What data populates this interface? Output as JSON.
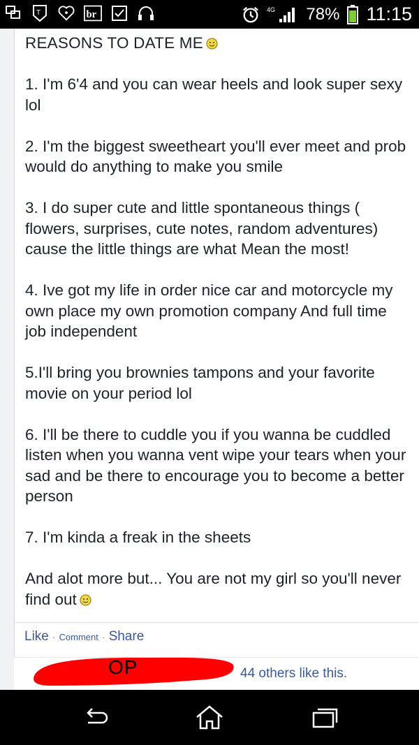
{
  "status_bar": {
    "network_label": "4G",
    "battery_percent": "78%",
    "time": "11:15"
  },
  "post": {
    "title": "REASONS TO DATE ME",
    "paragraphs": [
      "1. I'm 6'4 and you can wear heels and look super sexy lol",
      "2. I'm the biggest sweetheart you'll ever meet and prob would do anything to make you smile",
      "3. I do super cute and little spontaneous things ( flowers, surprises, cute notes, random adventures) cause the little things are what Mean the most!",
      "4. Ive got my life in order nice car and motorcycle my own place my own promotion company And full time job independent",
      "5.I'll bring you brownies tampons and your favorite movie on your period lol",
      "6. I'll be there to cuddle you if you wanna be cuddled listen when you wanna vent wipe your tears when your sad and be there to encourage you to become a better person",
      "7. I'm kinda a freak in the sheets"
    ],
    "closing": "And alot more but... You are not my girl so you'll never find out"
  },
  "actions": {
    "like": "Like",
    "comment": "Comment",
    "share": "Share",
    "separator": "·"
  },
  "likes": {
    "others_text": "44 others like this.",
    "redaction_label": "OP"
  },
  "colors": {
    "link": "#3b5998",
    "redaction": "#ff0000"
  }
}
